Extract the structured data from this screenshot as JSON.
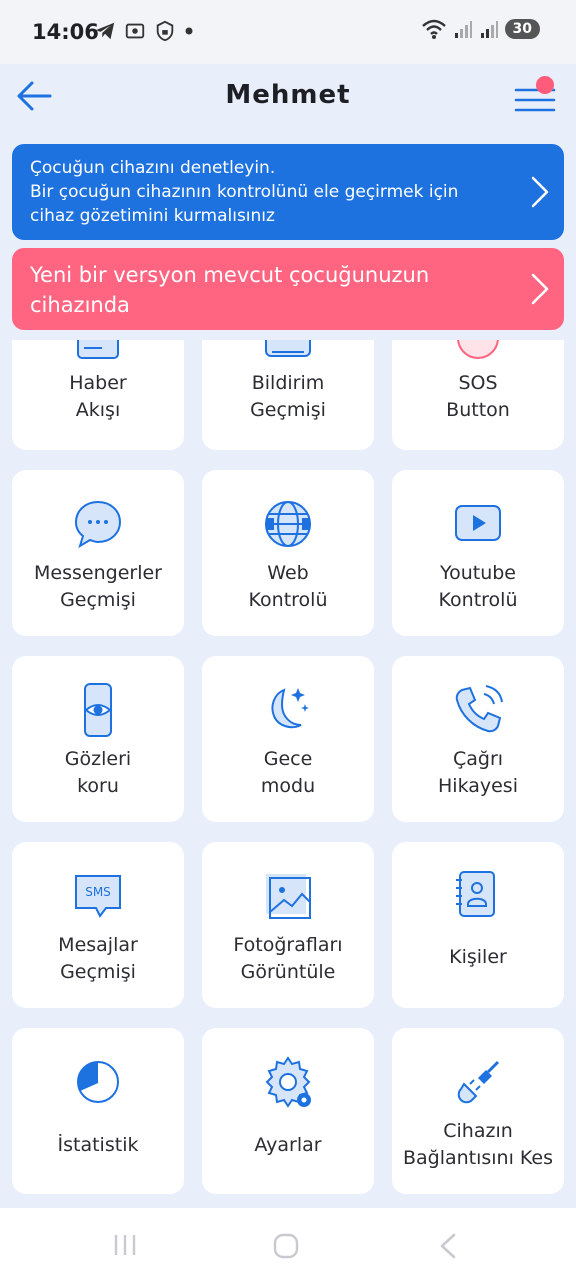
{
  "status": {
    "time": "14:06",
    "battery": "30"
  },
  "header": {
    "title": "Mehmet"
  },
  "banners": {
    "control": {
      "title": "Çocuğun cihazını denetleyin.",
      "text": "Bir çocuğun cihazının kontrolünü ele geçirmek için cihaz gözetimini kurmalısınız"
    },
    "update": {
      "text": "Yeni bir versyon mevcut çocuğunuzun cihazında"
    }
  },
  "tiles": [
    {
      "line1": "Haber",
      "line2": "Akışı"
    },
    {
      "line1": "Bildirim",
      "line2": "Geçmişi"
    },
    {
      "line1": "SOS",
      "line2": "Button"
    },
    {
      "line1": "Messengerler",
      "line2": "Geçmişi"
    },
    {
      "line1": "Web",
      "line2": "Kontrolü"
    },
    {
      "line1": "Youtube",
      "line2": "Kontrolü"
    },
    {
      "line1": "Gözleri",
      "line2": "koru"
    },
    {
      "line1": "Gece",
      "line2": "modu"
    },
    {
      "line1": "Çağrı",
      "line2": "Hikayesi"
    },
    {
      "line1": "Mesajlar",
      "line2": "Geçmişi"
    },
    {
      "line1": "Fotoğrafları",
      "line2": "Görüntüle"
    },
    {
      "line1": "Kişiler",
      "line2": ""
    },
    {
      "line1": "İstatistik",
      "line2": ""
    },
    {
      "line1": "Ayarlar",
      "line2": ""
    },
    {
      "line1": "Cihazın",
      "line2": "Bağlantısını Kes"
    }
  ],
  "icons": {
    "sms_text": "SMS"
  },
  "colors": {
    "accent": "#1d72e0",
    "alert": "#ff6480",
    "background": "#e9eefb"
  }
}
